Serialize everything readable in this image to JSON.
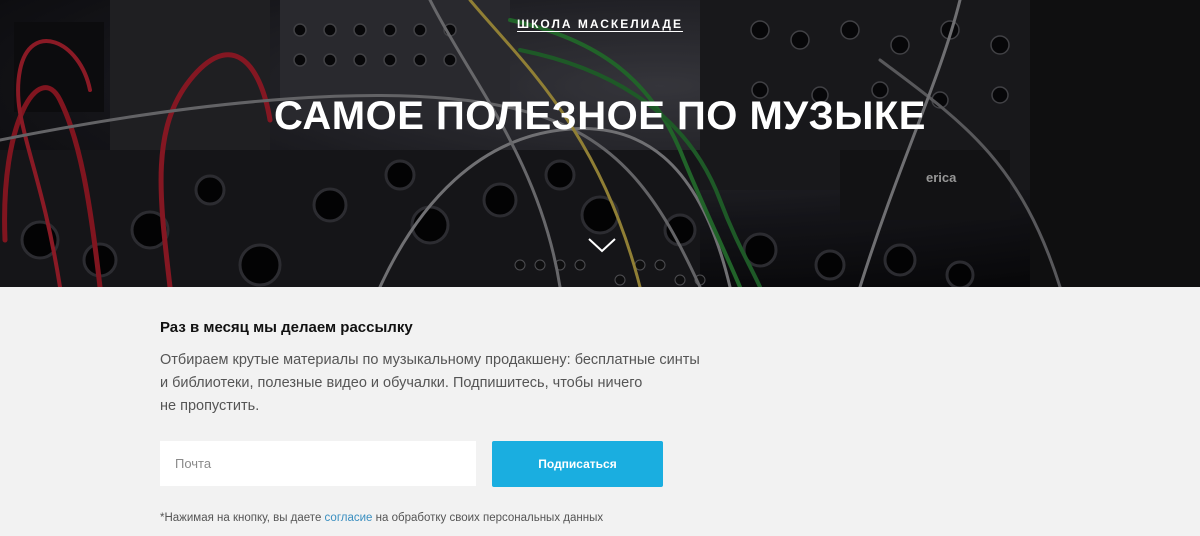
{
  "hero": {
    "school_link": "ШКОЛА МАСКЕЛИАДЕ",
    "title": "САМОЕ ПОЛЕЗНОЕ ПО МУЗЫКЕ",
    "panel_label": "erica",
    "scroll_icon": "chevron-down-icon"
  },
  "subscribe": {
    "heading": "Раз в месяц мы делаем рассылку",
    "description_lines": [
      "Отбираем крутые материалы по музыкальному продакшену: бесплатные синты",
      "и библиотеки, полезные видео и обучалки. Подпишитесь, чтобы ничего",
      "не пропустить."
    ],
    "email_placeholder": "Почта",
    "button_label": "Подписаться",
    "note_prefix": "*Нажимая на кнопку, вы даете ",
    "note_link": "согласие",
    "note_suffix": " на обработку своих персональных данных"
  },
  "colors": {
    "accent": "#1aaee0",
    "link": "#3a8fc0",
    "background": "#f2f2f2"
  }
}
